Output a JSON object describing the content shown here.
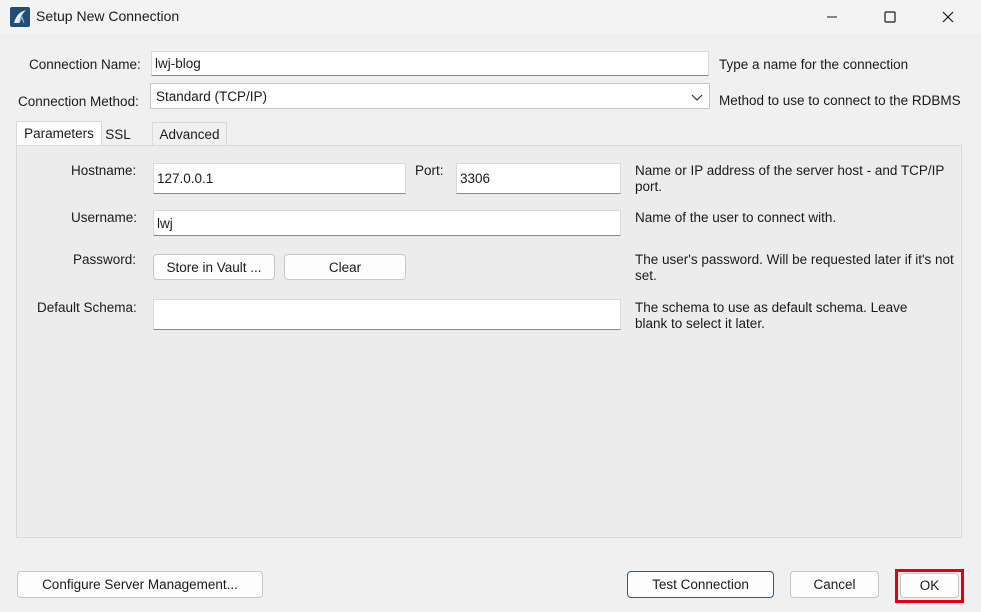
{
  "window": {
    "title": "Setup New Connection",
    "icon": "mysql-workbench-icon",
    "controls": [
      "minimize-icon",
      "maximize-icon",
      "close-icon"
    ]
  },
  "connection_name": {
    "label": "Connection Name:",
    "value": "lwj-blog",
    "help": "Type a name for the connection"
  },
  "connection_method": {
    "label": "Connection Method:",
    "value": "Standard (TCP/IP)",
    "help": "Method to use to connect to the RDBMS"
  },
  "tabs": [
    {
      "label": "Parameters",
      "active": true
    },
    {
      "label": "SSL",
      "active": false
    },
    {
      "label": "Advanced",
      "active": false
    }
  ],
  "parameters": {
    "hostname": {
      "label": "Hostname:",
      "value": "127.0.0.1",
      "help": "Name or IP address of the server host - and TCP/IP port."
    },
    "port": {
      "label": "Port:",
      "value": "3306"
    },
    "username": {
      "label": "Username:",
      "value": "lwj",
      "help": "Name of the user to connect with."
    },
    "password": {
      "label": "Password:",
      "store_button": "Store in Vault ...",
      "clear_button": "Clear",
      "help": "The user's password. Will be requested later if it's not set."
    },
    "default_schema": {
      "label": "Default Schema:",
      "value": "",
      "help": "The schema to use as default schema. Leave blank to select it later."
    }
  },
  "footer": {
    "configure_button": "Configure Server Management...",
    "test_button": "Test Connection",
    "cancel_button": "Cancel",
    "ok_button": "OK",
    "highlight_color": "#e0000f"
  }
}
